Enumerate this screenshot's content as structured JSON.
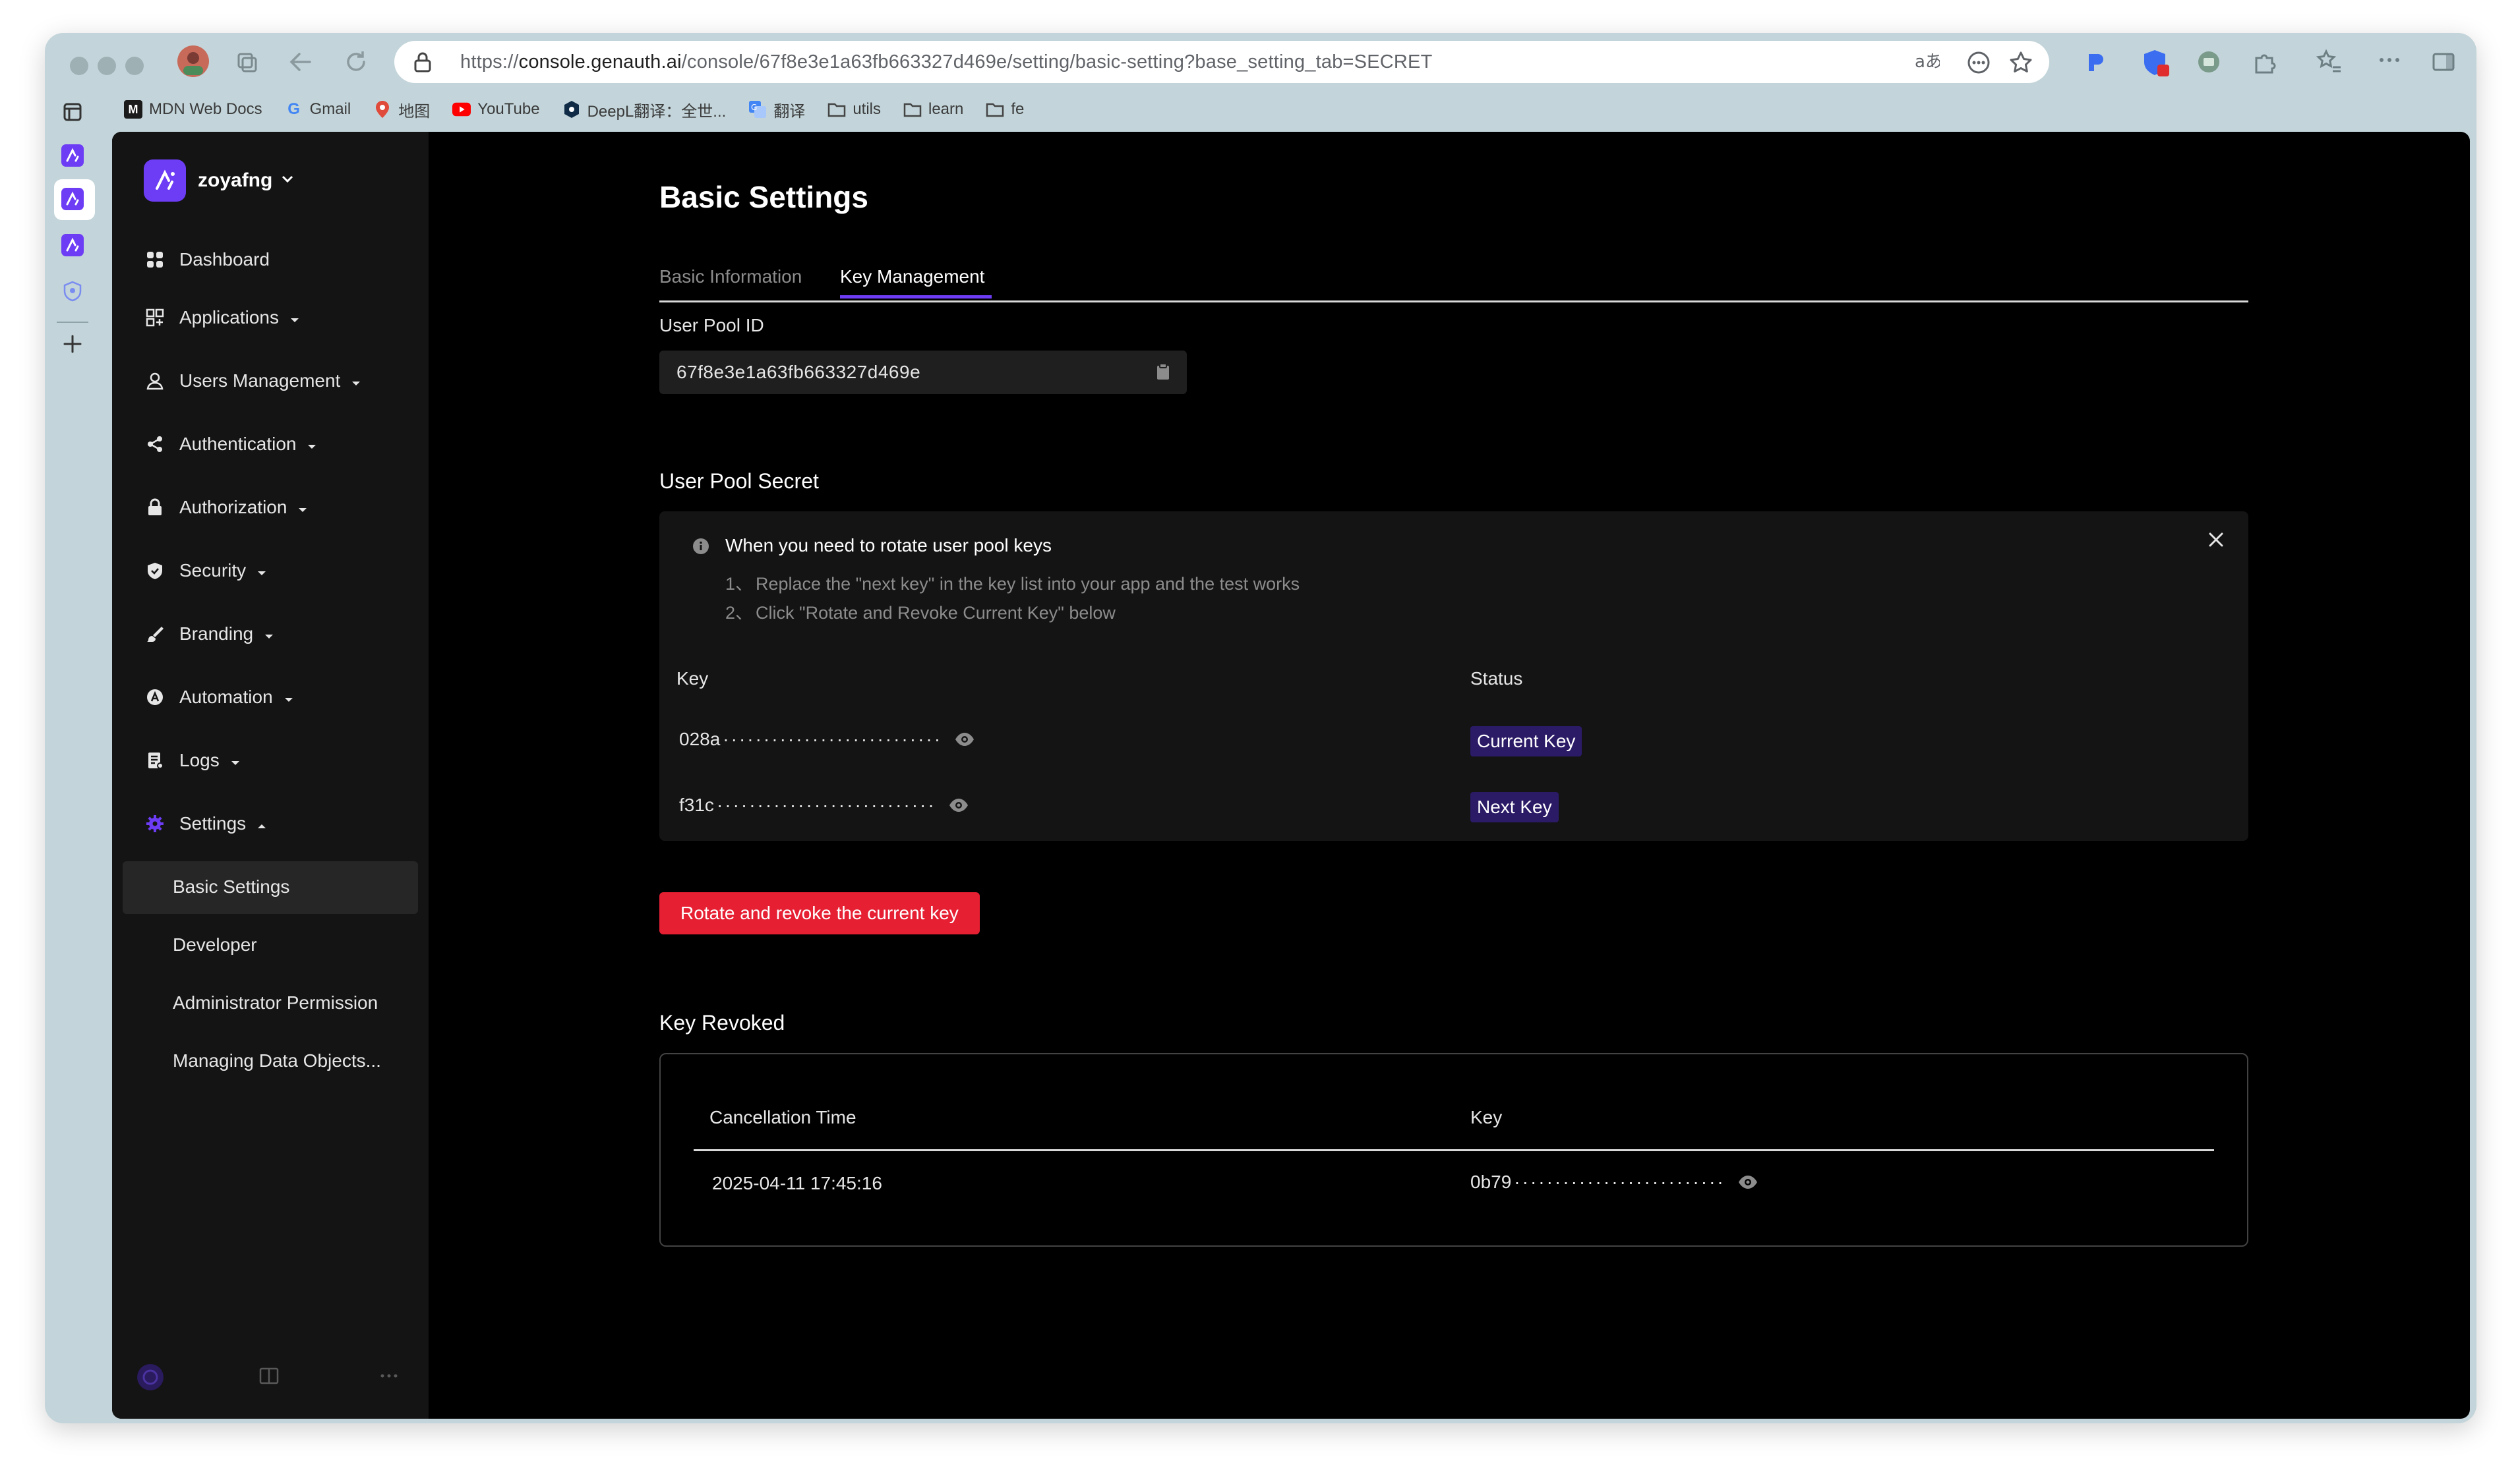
{
  "browser": {
    "url_scheme": "https://",
    "url_host": "console.genauth.ai",
    "url_path": "/console/67f8e3e1a63fb663327d469e/setting/basic-setting?base_setting_tab=SECRET",
    "bookmarks": [
      {
        "label": "MDN Web Docs",
        "icon": "mdn-icon"
      },
      {
        "label": "Gmail",
        "icon": "google-icon"
      },
      {
        "label": "地图",
        "icon": "map-pin-icon"
      },
      {
        "label": "YouTube",
        "icon": "youtube-icon"
      },
      {
        "label": "DeepL翻译：全世...",
        "icon": "deepl-icon"
      },
      {
        "label": "翻译",
        "icon": "translate-icon"
      },
      {
        "label": "utils",
        "icon": "folder-icon"
      },
      {
        "label": "learn",
        "icon": "folder-icon"
      },
      {
        "label": "fe",
        "icon": "folder-icon"
      }
    ]
  },
  "sidebar": {
    "org_name": "zoyafng",
    "items": [
      {
        "label": "Dashboard",
        "icon": "dashboard-icon"
      },
      {
        "label": "Applications",
        "icon": "apps-grid-icon"
      },
      {
        "label": "Users Management",
        "icon": "user-icon"
      },
      {
        "label": "Authentication",
        "icon": "share-nodes-icon"
      },
      {
        "label": "Authorization",
        "icon": "lock-icon"
      },
      {
        "label": "Security",
        "icon": "shield-icon"
      },
      {
        "label": "Branding",
        "icon": "brush-icon"
      },
      {
        "label": "Automation",
        "icon": "automation-icon"
      },
      {
        "label": "Logs",
        "icon": "log-icon"
      },
      {
        "label": "Settings",
        "icon": "gear-icon"
      }
    ],
    "sub_items": [
      {
        "label": "Basic Settings"
      },
      {
        "label": "Developer"
      },
      {
        "label": "Administrator Permission"
      },
      {
        "label": "Managing Data Objects..."
      }
    ]
  },
  "main": {
    "title": "Basic Settings",
    "tabs": [
      {
        "label": "Basic Information",
        "active": false
      },
      {
        "label": "Key Management",
        "active": true
      }
    ],
    "user_pool_id_label": "User Pool ID",
    "user_pool_id": "67f8e3e1a63fb663327d469e",
    "user_pool_secret_title": "User Pool Secret",
    "alert": {
      "title": "When you need to rotate user pool keys",
      "steps": [
        {
          "num": "1、",
          "text": "Replace the \"next key\" in the key list into your app and the test works"
        },
        {
          "num": "2、",
          "text": "Click \"Rotate and Revoke Current Key\" below"
        }
      ]
    },
    "key_table": {
      "headers": {
        "key": "Key",
        "status": "Status"
      },
      "rows": [
        {
          "prefix": "028a",
          "mask": "···························",
          "status": "Current Key"
        },
        {
          "prefix": "f31c",
          "mask": "···························",
          "status": "Next Key"
        }
      ]
    },
    "rotate_button": "Rotate and revoke the current key",
    "revoked_title": "Key Revoked",
    "revoked_table": {
      "headers": {
        "time": "Cancellation Time",
        "key": "Key"
      },
      "rows": [
        {
          "time": "2025-04-11 17:45:16",
          "prefix": "0b79",
          "mask": "··························"
        }
      ]
    }
  },
  "colors": {
    "accent": "#6d3cf5",
    "danger": "#e61f33",
    "badge_bg": "#2b1a66",
    "sidebar_bg": "#141414",
    "page_bg": "#000000"
  }
}
